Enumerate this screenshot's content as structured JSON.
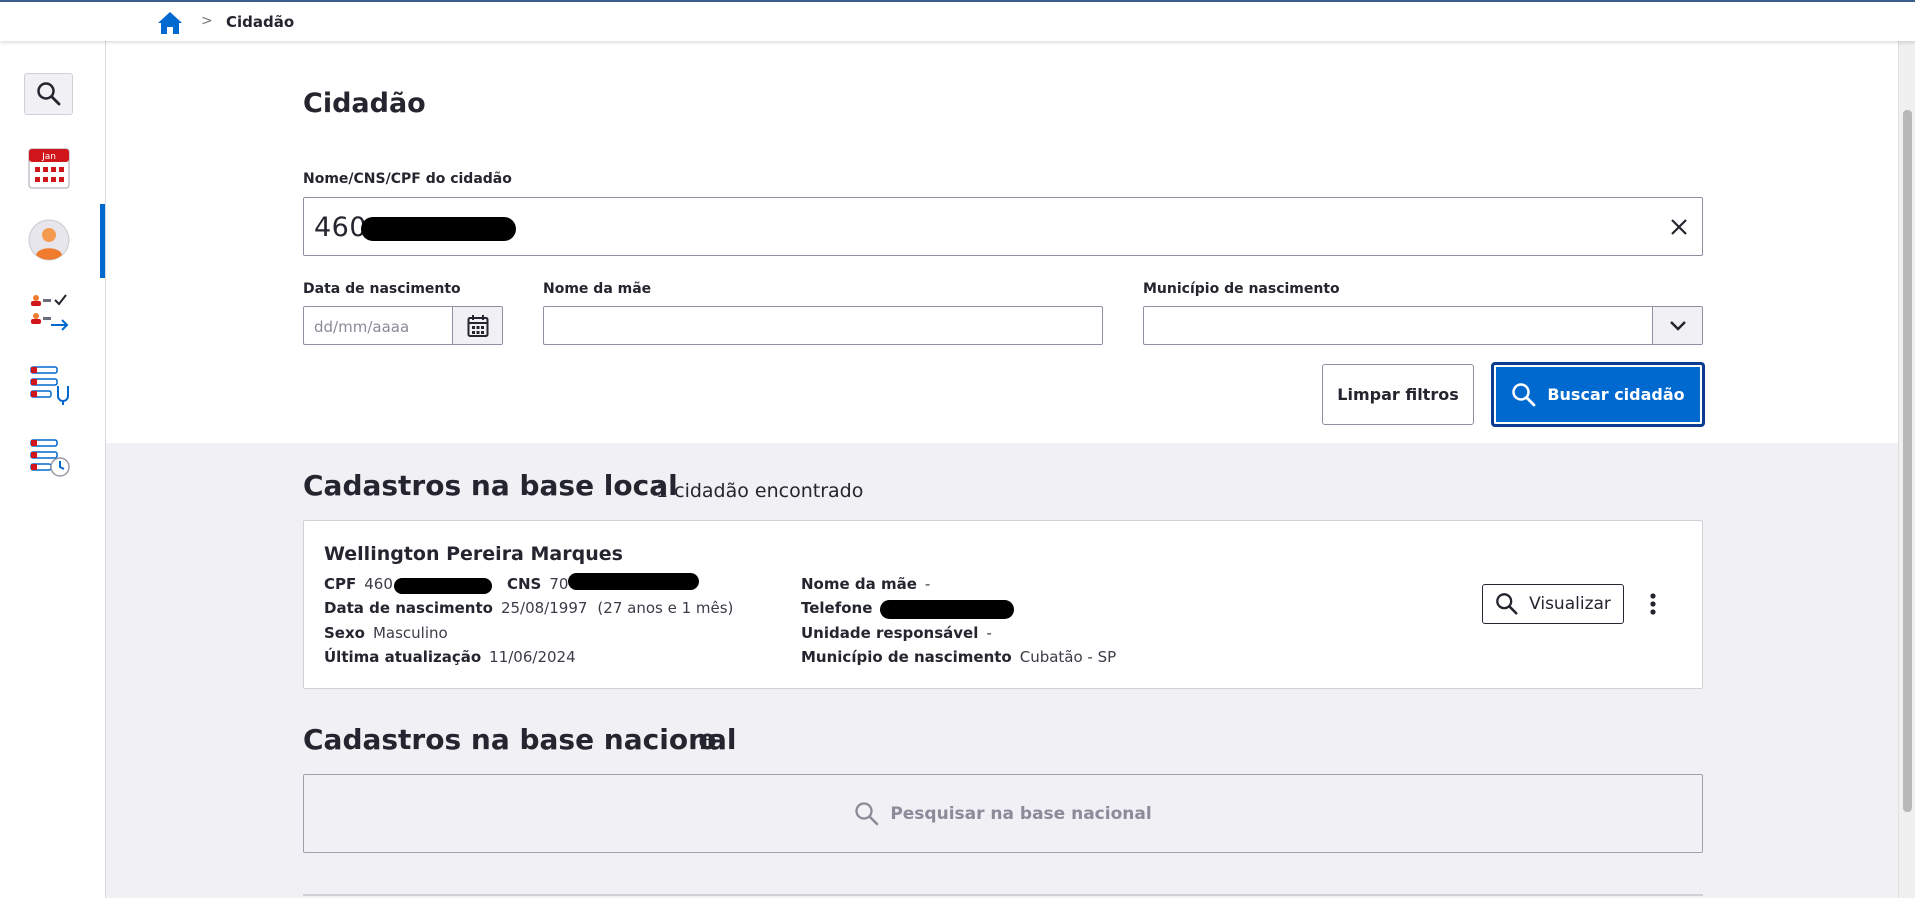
{
  "breadcrumb": {
    "home_icon": "home-icon",
    "separator": ">",
    "current": "Cidadão"
  },
  "sidebar": {
    "items": [
      {
        "name": "search",
        "icon": "search-icon"
      },
      {
        "name": "agenda",
        "icon": "calendar-icon",
        "calendar_label": "Jan"
      },
      {
        "name": "cidadao",
        "icon": "person-icon",
        "active": true
      },
      {
        "name": "lista-atendimento",
        "icon": "queue-icon"
      },
      {
        "name": "atendimentos",
        "icon": "stethoscope-list-icon"
      },
      {
        "name": "historico",
        "icon": "clock-list-icon"
      }
    ]
  },
  "page": {
    "title": "Cidadão"
  },
  "filters": {
    "search_label": "Nome/CNS/CPF do cidadão",
    "search_value": "460",
    "birth_label": "Data de nascimento",
    "birth_placeholder": "dd/mm/aaaa",
    "mother_label": "Nome da mãe",
    "mother_value": "",
    "municipality_label": "Município de nascimento",
    "municipality_value": ""
  },
  "actions": {
    "clear_label": "Limpar filtros",
    "search_label": "Buscar cidadão"
  },
  "local": {
    "title": "Cadastros na base local",
    "count_text": "1 cidadão encontrado",
    "citizen": {
      "name": "Wellington Pereira Marques",
      "cpf_label": "CPF",
      "cpf_value": "460",
      "cns_label": "CNS",
      "cns_value": "70",
      "birth_label": "Data de nascimento",
      "birth_value": "25/08/1997",
      "age_text": "(27 anos e 1 mês)",
      "sex_label": "Sexo",
      "sex_value": "Masculino",
      "updated_label": "Última atualização",
      "updated_value": "11/06/2024",
      "mother_label": "Nome da mãe",
      "mother_value": "-",
      "phone_label": "Telefone",
      "phone_value": "(",
      "unit_label": "Unidade responsável",
      "unit_value": "-",
      "municipality_label": "Município de nascimento",
      "municipality_value": "Cubatão - SP",
      "view_label": "Visualizar"
    }
  },
  "national": {
    "title": "Cadastros na base nacional",
    "search_label": "Pesquisar na base nacional"
  },
  "colors": {
    "primary": "#0069d0",
    "text": "#24252e",
    "muted_bg": "#f0f0f5"
  }
}
